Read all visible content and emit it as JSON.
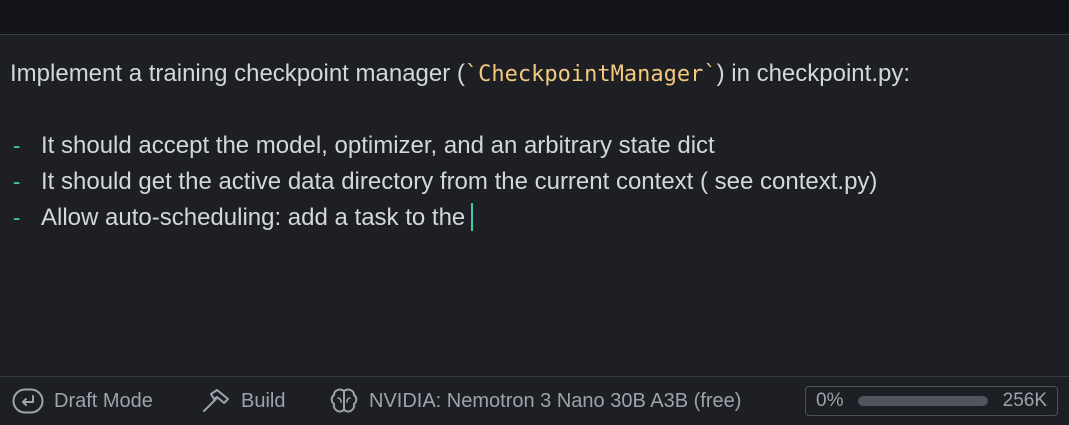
{
  "editor": {
    "line1_prefix": "Implement a training checkpoint manager (",
    "line1_tick_open": "`",
    "line1_code": "CheckpointManager",
    "line1_tick_close": "`",
    "line1_suffix": ") in checkpoint.py:",
    "bullet_marker": "-",
    "bullets": [
      "It should accept the model, optimizer, and an arbitrary state dict",
      "It should get the active data directory from the current context ( see context.py)",
      "Allow auto-scheduling: add a task to the"
    ]
  },
  "status": {
    "mode_label": "Draft Mode",
    "mode_icon": "enter-return-icon",
    "build_label": "Build",
    "build_icon": "hammer-icon",
    "model_label": "NVIDIA: Nemotron 3 Nano 30B A3B (free)",
    "model_icon": "brain-icon",
    "usage_percent": "0%",
    "usage_fraction": 0,
    "usage_max": "256K"
  },
  "colors": {
    "background": "#1d1f24",
    "topbar": "#121418",
    "text": "#d3d6da",
    "muted": "#9ea3aa",
    "code": "#f2c97d",
    "accent": "#3ec9a7"
  }
}
